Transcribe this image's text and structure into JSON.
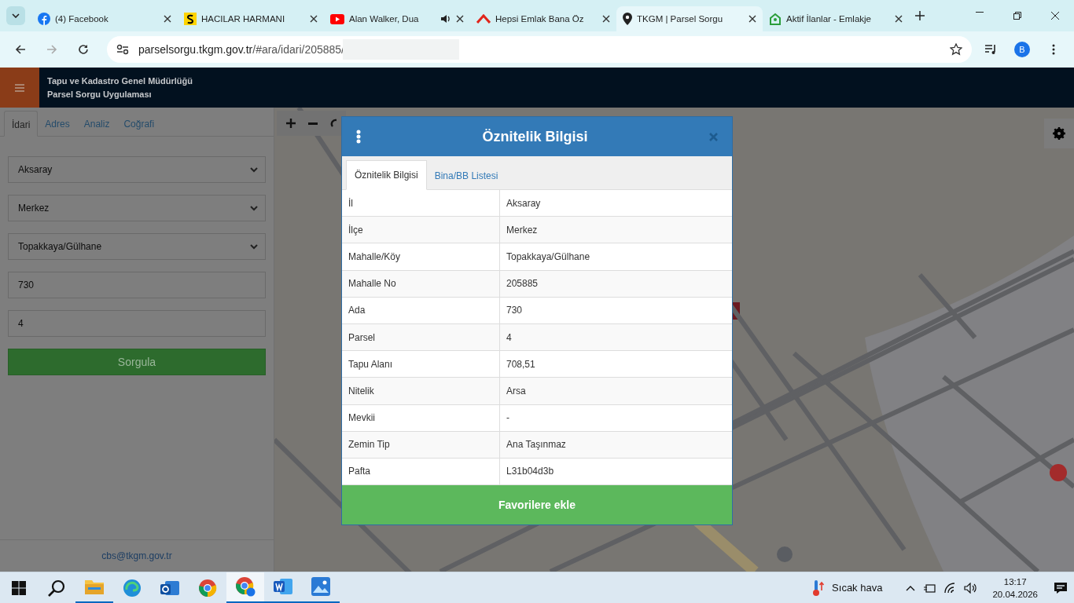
{
  "browser": {
    "tabs": [
      {
        "title": "(4) Facebook",
        "selected": false,
        "audio": false
      },
      {
        "title": "HACILAR HARMANI",
        "selected": false,
        "audio": false
      },
      {
        "title": "Alan Walker, Dua",
        "selected": false,
        "audio": true
      },
      {
        "title": "Hepsi Emlak Bana Öz",
        "selected": false,
        "audio": false
      },
      {
        "title": "TKGM | Parsel Sorgu",
        "selected": true,
        "audio": false
      },
      {
        "title": "Aktif İlanlar - Emlakje",
        "selected": false,
        "audio": false
      }
    ],
    "url_host": "parselsorgu.tkgm.gov.tr",
    "url_path": "/#ara/idari/205885/",
    "profile": "B"
  },
  "app": {
    "header": {
      "line_1": "Tapu ve Kadastro Genel Müdürlüğü",
      "line_2": "Parsel Sorgu Uygulaması"
    },
    "sidebar": {
      "tabs": [
        {
          "label": "İdari",
          "selected": true
        },
        {
          "label": "Adres",
          "selected": false
        },
        {
          "label": "Analiz",
          "selected": false
        },
        {
          "label": "Coğrafi",
          "selected": false
        }
      ],
      "fields": [
        {
          "kind": "select",
          "value": "Aksaray"
        },
        {
          "kind": "select",
          "value": "Merkez"
        },
        {
          "kind": "select",
          "value": "Topakkaya/Gülhane"
        },
        {
          "kind": "input",
          "value": "730"
        },
        {
          "kind": "input",
          "value": "4"
        }
      ],
      "button": "Sorgula",
      "footer_link": "cbs@tkgm.gov.tr"
    },
    "modal": {
      "title": "Öznitelik Bilgisi",
      "tabs": [
        {
          "label": "Öznitelik Bilgisi",
          "selected": true
        },
        {
          "label": "Bina/BB Listesi",
          "selected": false
        }
      ],
      "rows": [
        {
          "label": "İl",
          "value": "Aksaray"
        },
        {
          "label": "İlçe",
          "value": "Merkez"
        },
        {
          "label": "Mahalle/Köy",
          "value": "Topakkaya/Gülhane"
        },
        {
          "label": "Mahalle No",
          "value": "205885"
        },
        {
          "label": "Ada",
          "value": "730"
        },
        {
          "label": "Parsel",
          "value": "4"
        },
        {
          "label": "Tapu Alanı",
          "value": "708,51"
        },
        {
          "label": "Nitelik",
          "value": "Arsa"
        },
        {
          "label": "Mevkii",
          "value": "-"
        },
        {
          "label": "Zemin Tip",
          "value": "Ana Taşınmaz"
        },
        {
          "label": "Pafta",
          "value": "L31b04d3b"
        }
      ],
      "button": "Favorilere ekle"
    }
  },
  "taskbar": {
    "weather": "Sıcak hava",
    "time": "13:17",
    "date": "20.04.2026"
  }
}
